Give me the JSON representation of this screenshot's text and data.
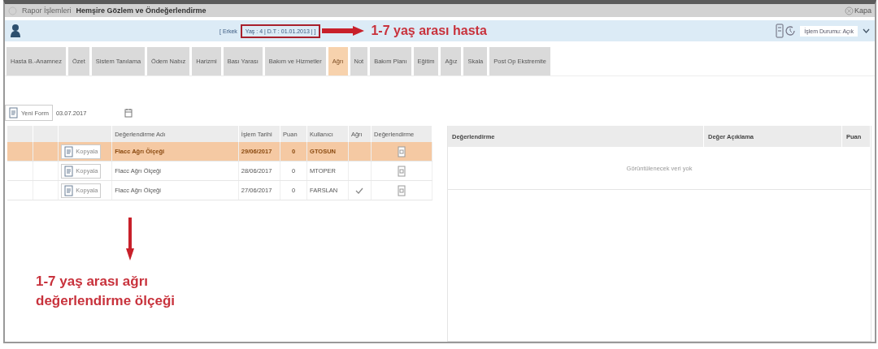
{
  "title_bar": {
    "breadcrumb": "Rapor İşlemleri",
    "title": "Hemşire Gözlem ve Öndeğerlendirme",
    "close_label": "Kapa"
  },
  "patient_bar": {
    "gender": "[ Erkek",
    "info": "Yaş : 4 | D.T : 01.01.2013 | ]",
    "status": "İşlem Durumu: Açık"
  },
  "tabs": [
    {
      "label": "Hasta B.-Anamnez",
      "selected": false
    },
    {
      "label": "Özet",
      "selected": false
    },
    {
      "label": "Sistem Tanılama",
      "selected": false
    },
    {
      "label": "Ödem Nabız",
      "selected": false
    },
    {
      "label": "Harizmi",
      "selected": false
    },
    {
      "label": "Bası Yarası",
      "selected": false
    },
    {
      "label": "Bakım ve Hizmetler",
      "selected": false
    },
    {
      "label": "Ağrı",
      "selected": true
    },
    {
      "label": "Not",
      "selected": false
    },
    {
      "label": "Bakım Planı",
      "selected": false
    },
    {
      "label": "Eğitim",
      "selected": false
    },
    {
      "label": "Ağız",
      "selected": false
    },
    {
      "label": "Skala",
      "selected": false
    },
    {
      "label": "Post Op Ekstremite",
      "selected": false
    }
  ],
  "toolbar": {
    "new_form": "Yeni Form",
    "date": "03.07.2017"
  },
  "left_table": {
    "columns": [
      "Değerlendirme Adı",
      "İşlem Tarihi",
      "Puan",
      "Kullanıcı",
      "Ağrı",
      "Değerlendirme"
    ],
    "rows": [
      {
        "copy": "Kopyala",
        "name": "Flacc Ağrı Ölçeği",
        "date": "29/06/2017",
        "score": "0",
        "user": "GTOSUN",
        "pain": false,
        "selected": true
      },
      {
        "copy": "Kopyala",
        "name": "Flacc Ağrı Ölçeği",
        "date": "28/06/2017",
        "score": "0",
        "user": "MTOPER",
        "pain": false,
        "selected": false
      },
      {
        "copy": "Kopyala",
        "name": "Flacc Ağrı Ölçeği",
        "date": "27/06/2017",
        "score": "0",
        "user": "FARSLAN",
        "pain": true,
        "selected": false
      }
    ]
  },
  "right_table": {
    "columns": [
      "Değerlendirme",
      "Değer Açıklama",
      "Puan"
    ],
    "empty": "Görüntülenecek veri yok"
  },
  "annotations": [
    {
      "text": "1-7 yaş arası hasta"
    },
    {
      "text": "1-7 yaş arası ağrı değerlendirme ölçeği"
    }
  ]
}
